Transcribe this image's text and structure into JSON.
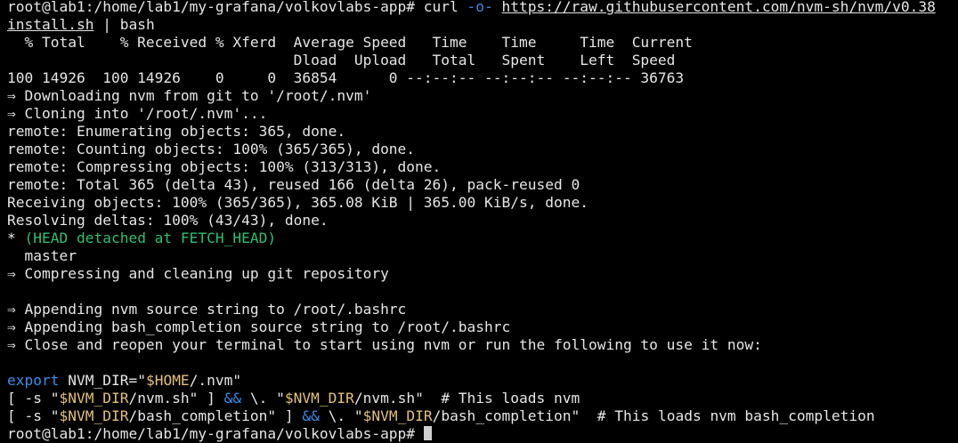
{
  "terminal": {
    "prompt": "root@lab1:/home/lab1/my-grafana/volkovlabs-app# ",
    "cmd_curl": "curl ",
    "cmd_flag": "-o-",
    "cmd_space": " ",
    "cmd_url_1": "https://raw.githubusercontent.com/nvm-sh/nvm/v0.38",
    "cmd_url_2": "install.sh",
    "cmd_pipe": " | bash",
    "progress_header_1": "  % Total    % Received % Xferd  Average Speed   Time    Time     Time  Current",
    "progress_header_2": "                                 Dload  Upload   Total   Spent    Left  Speed",
    "progress_row": "100 14926  100 14926    0     0  36854      0 --:--:-- --:--:-- --:--:-- 36763",
    "out_1": "⇒ Downloading nvm from git to '/root/.nvm'",
    "out_2": "⇒ Cloning into '/root/.nvm'...",
    "out_3": "remote: Enumerating objects: 365, done.",
    "out_4": "remote: Counting objects: 100% (365/365), done.",
    "out_5": "remote: Compressing objects: 100% (313/313), done.",
    "out_6": "remote: Total 365 (delta 43), reused 166 (delta 26), pack-reused 0",
    "out_7": "Receiving objects: 100% (365/365), 365.08 KiB | 365.00 KiB/s, done.",
    "out_8": "Resolving deltas: 100% (43/43), done.",
    "head_star": "* ",
    "head_text": "(HEAD detached at FETCH_HEAD)",
    "branch_master": "  master",
    "out_9": "⇒ Compressing and cleaning up git repository",
    "out_10": "⇒ Appending nvm source string to /root/.bashrc",
    "out_11": "⇒ Appending bash_completion source string to /root/.bashrc",
    "out_12": "⇒ Close and reopen your terminal to start using nvm or run the following to use it now:",
    "export_kw": "export",
    "export_rest": " NVM_DIR=\"",
    "export_home": "$HOME",
    "export_end": "/.nvm\"",
    "l1_a": "[ -s \"",
    "l1_var": "$NVM_DIR",
    "l1_b": "/nvm.sh\" ] ",
    "l1_and": "&&",
    "l1_c": " \\. \"",
    "l1_var2": "$NVM_DIR",
    "l1_d": "/nvm.sh\"  # This loads nvm",
    "l2_a": "[ -s \"",
    "l2_var": "$NVM_DIR",
    "l2_b": "/bash_completion\" ] ",
    "l2_and": "&&",
    "l2_c": " \\. \"",
    "l2_var2": "$NVM_DIR",
    "l2_d": "/bash_completion\"  # This loads nvm bash_completion",
    "final_prompt": "root@lab1:/home/lab1/my-grafana/volkovlabs-app# "
  },
  "colors": {
    "background": "#000000",
    "foreground": "#e6e6e6",
    "green": "#2fbf71",
    "blue": "#3b8eea",
    "yellow": "#e5c07b"
  }
}
